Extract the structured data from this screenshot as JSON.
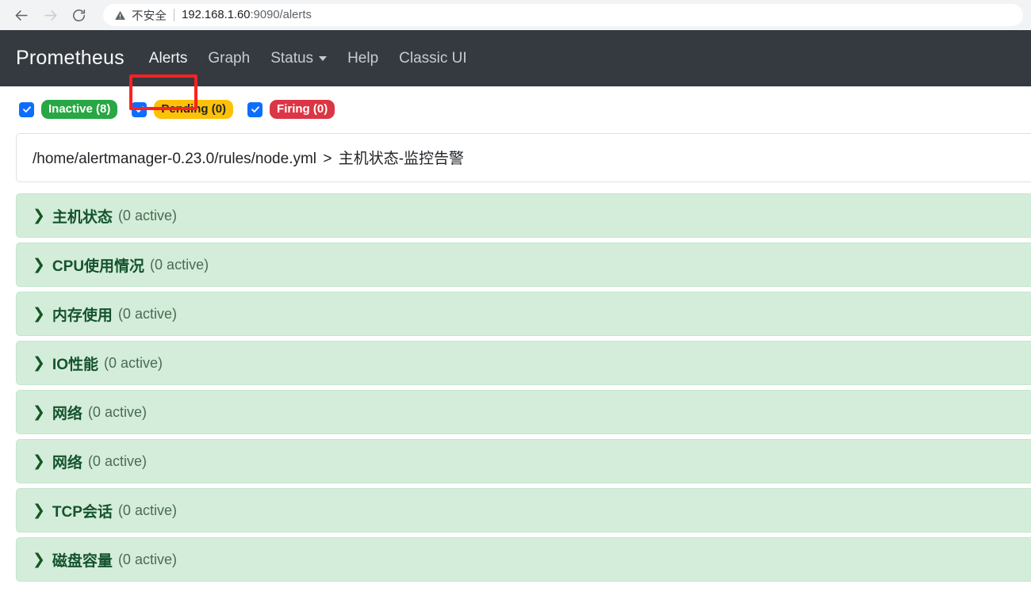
{
  "browser": {
    "back_icon": "back-arrow-icon",
    "forward_icon": "forward-arrow-icon",
    "reload_icon": "reload-icon",
    "security_icon": "warning-triangle-icon",
    "security_label": "不安全",
    "url_host": "192.168.1.60",
    "url_port_path": ":9090/alerts",
    "url_full": "192.168.1.60:9090/alerts"
  },
  "navbar": {
    "brand": "Prometheus",
    "links": [
      {
        "label": "Alerts",
        "active": true,
        "has_caret": false
      },
      {
        "label": "Graph",
        "active": false,
        "has_caret": false
      },
      {
        "label": "Status",
        "active": false,
        "has_caret": true
      },
      {
        "label": "Help",
        "active": false,
        "has_caret": false
      },
      {
        "label": "Classic UI",
        "active": false,
        "has_caret": false
      }
    ],
    "highlight_color": "#ff2020",
    "background": "#343a40"
  },
  "filters": [
    {
      "label": "Inactive (8)",
      "state": "Inactive",
      "count": 8,
      "checked": true,
      "color": "#28a745"
    },
    {
      "label": "Pending (0)",
      "state": "Pending",
      "count": 0,
      "checked": true,
      "color": "#ffc107"
    },
    {
      "label": "Firing (0)",
      "state": "Firing",
      "count": 0,
      "checked": true,
      "color": "#dc3545"
    }
  ],
  "rule_file": {
    "path": "/home/alertmanager-0.23.0/rules/node.yml",
    "separator": ">",
    "group": "主机状态-监控告警"
  },
  "groups": [
    {
      "chevron": "❯",
      "name": "主机状态",
      "count": "(0 active)"
    },
    {
      "chevron": "❯",
      "name": "CPU使用情况",
      "count": "(0 active)"
    },
    {
      "chevron": "❯",
      "name": "内存使用",
      "count": "(0 active)"
    },
    {
      "chevron": "❯",
      "name": "IO性能",
      "count": "(0 active)"
    },
    {
      "chevron": "❯",
      "name": "网络",
      "count": "(0 active)"
    },
    {
      "chevron": "❯",
      "name": "网络",
      "count": "(0 active)"
    },
    {
      "chevron": "❯",
      "name": "TCP会话",
      "count": "(0 active)"
    },
    {
      "chevron": "❯",
      "name": "磁盘容量",
      "count": "(0 active)"
    }
  ]
}
